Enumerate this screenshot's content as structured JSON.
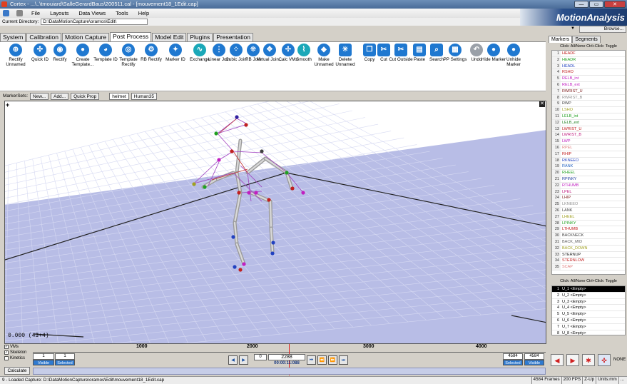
{
  "window": {
    "title": "Cortex - ...\\..\\tmouiard\\SalleGerardBaus\\200511.cal - [mouvement18_1Edit.cap]",
    "minimize": "—",
    "maximize": "▭",
    "close": "✕"
  },
  "menu": [
    "File",
    "Layouts",
    "Data Views",
    "Tools",
    "Help"
  ],
  "brand": "MotionAnalysis",
  "current_directory": {
    "label": "Current Directory:",
    "value": "D:\\DataMotionCapture\\oramos\\Edit\\",
    "browse": "Browse..."
  },
  "tabs": [
    "System",
    "Calibration",
    "Motion Capture",
    "Post Process",
    "Model Edit",
    "Plugins",
    "Presentation"
  ],
  "active_tab": "Post Process",
  "tools": [
    {
      "label": "Rectify Unnamed",
      "icon": "target-icon",
      "glyph": "⊕"
    },
    {
      "label": "Quick ID",
      "icon": "quick-id-icon",
      "glyph": "✣"
    },
    {
      "label": "Rectify",
      "icon": "rectify-icon",
      "glyph": "◉"
    },
    {
      "label": "Create Template...",
      "icon": "create-template-icon",
      "glyph": "●"
    },
    {
      "label": "Template ID",
      "icon": "template-id-icon",
      "glyph": "◕"
    },
    {
      "label": "Template Rectify",
      "icon": "template-rectify-icon",
      "glyph": "◎"
    },
    {
      "label": "RB Rectify",
      "icon": "rb-rectify-icon",
      "glyph": "⚙"
    },
    {
      "label": "Marker ID",
      "icon": "marker-id-icon",
      "glyph": "✦"
    },
    {
      "label": "Exchange",
      "icon": "exchange-icon",
      "glyph": "∿"
    },
    {
      "label": "Linear Join",
      "icon": "linear-join-icon",
      "glyph": "⋮"
    },
    {
      "label": "Cubic Join",
      "icon": "cubic-join-icon",
      "glyph": "⁘"
    },
    {
      "label": "RB Join",
      "icon": "rb-join-icon",
      "glyph": "⁜"
    },
    {
      "label": "Virtual Join...",
      "icon": "virtual-join-icon",
      "glyph": "✥"
    },
    {
      "label": "Calc VMs",
      "icon": "calc-vms-icon",
      "glyph": "✢"
    },
    {
      "label": "Smooth",
      "icon": "smooth-icon",
      "glyph": "⌇"
    },
    {
      "label": "Make Unnamed",
      "icon": "make-unnamed-icon",
      "glyph": "◆"
    },
    {
      "label": "Delete Unnamed",
      "icon": "delete-unnamed-icon",
      "glyph": "✳"
    },
    {
      "label": "Copy",
      "icon": "copy-icon",
      "glyph": "❐"
    },
    {
      "label": "Cut",
      "icon": "cut-icon",
      "glyph": "✂"
    },
    {
      "label": "Cut Outside",
      "icon": "cut-outside-icon",
      "glyph": "✂"
    },
    {
      "label": "Paste",
      "icon": "paste-icon",
      "glyph": "▤"
    },
    {
      "label": "Search",
      "icon": "search-icon",
      "glyph": "⌕"
    },
    {
      "label": "PP Settings",
      "icon": "pp-settings-icon",
      "glyph": "▦"
    },
    {
      "label": "Undo",
      "icon": "undo-icon",
      "glyph": "↶"
    },
    {
      "label": "Hide Marker",
      "icon": "hide-marker-icon",
      "glyph": "●"
    },
    {
      "label": "Unhide Marker",
      "icon": "unhide-marker-icon",
      "glyph": "●"
    }
  ],
  "markersets": {
    "label": "MarkerSets:",
    "new": "New...",
    "add": "Add...",
    "quickprop": "Quick Prop",
    "tabs": [
      "helmet",
      "Human35"
    ]
  },
  "viewport": {
    "frame_readout": "0.000 (43+4)",
    "plus": "+",
    "close": "✕"
  },
  "right_tabs": [
    "Markers",
    "Segments"
  ],
  "hint": "Click: All/None  Ctrl+Click: Toggle",
  "markers": [
    {
      "n": "1",
      "name": "HEADF",
      "color": "#c02020"
    },
    {
      "n": "2",
      "name": "HEADR",
      "color": "#20a020"
    },
    {
      "n": "3",
      "name": "HEADL",
      "color": "#2040c0"
    },
    {
      "n": "4",
      "name": "RSHO",
      "color": "#c02020"
    },
    {
      "n": "5",
      "name": "RELB_int",
      "color": "#c020c0"
    },
    {
      "n": "6",
      "name": "RELB_ext",
      "color": "#c020c0"
    },
    {
      "n": "7",
      "name": "RWRIST_U",
      "color": "#802020"
    },
    {
      "n": "8",
      "name": "RWRIST_B",
      "color": "#909090"
    },
    {
      "n": "9",
      "name": "RWP",
      "color": "#404040"
    },
    {
      "n": "10",
      "name": "LSHO",
      "color": "#a0a020"
    },
    {
      "n": "11",
      "name": "LELB_int",
      "color": "#20a020"
    },
    {
      "n": "12",
      "name": "LELB_ext",
      "color": "#208020"
    },
    {
      "n": "13",
      "name": "LWRIST_U",
      "color": "#c02020"
    },
    {
      "n": "14",
      "name": "LWRIST_B",
      "color": "#c02080"
    },
    {
      "n": "15",
      "name": "LWP",
      "color": "#c020c0"
    },
    {
      "n": "16",
      "name": "RPEL",
      "color": "#e08080"
    },
    {
      "n": "17",
      "name": "RHIP",
      "color": "#c02020"
    },
    {
      "n": "18",
      "name": "RKNEEO",
      "color": "#2040c0"
    },
    {
      "n": "19",
      "name": "RANK",
      "color": "#2060c0"
    },
    {
      "n": "20",
      "name": "RHEEL",
      "color": "#20a020"
    },
    {
      "n": "21",
      "name": "RPINKY",
      "color": "#2040a0"
    },
    {
      "n": "22",
      "name": "RTHUMB",
      "color": "#c020c0"
    },
    {
      "n": "23",
      "name": "LPEL",
      "color": "#c02080"
    },
    {
      "n": "24",
      "name": "LHIP",
      "color": "#802020"
    },
    {
      "n": "25",
      "name": "LKNEEO",
      "color": "#909090"
    },
    {
      "n": "26",
      "name": "LANK",
      "color": "#404040"
    },
    {
      "n": "27",
      "name": "LHEEL",
      "color": "#a0a020"
    },
    {
      "n": "28",
      "name": "LPINKY",
      "color": "#20a020"
    },
    {
      "n": "29",
      "name": "LTHUMB",
      "color": "#c02020"
    },
    {
      "n": "30",
      "name": "BACKNECK",
      "color": "#404040"
    },
    {
      "n": "31",
      "name": "BACK_MID",
      "color": "#606060"
    },
    {
      "n": "32",
      "name": "BACK_DOWN",
      "color": "#a0a020"
    },
    {
      "n": "33",
      "name": "STERNUP",
      "color": "#202020"
    },
    {
      "n": "34",
      "name": "STERNLOW",
      "color": "#c02020"
    },
    {
      "n": "35",
      "name": "SCAP",
      "color": "#e08080"
    }
  ],
  "unnamed": [
    {
      "n": "1",
      "name": "U_1 <Empty>"
    },
    {
      "n": "2",
      "name": "U_2 <Empty>"
    },
    {
      "n": "3",
      "name": "U_3 <Empty>"
    },
    {
      "n": "4",
      "name": "U_4 <Empty>"
    },
    {
      "n": "5",
      "name": "U_5 <Empty>"
    },
    {
      "n": "6",
      "name": "U_6 <Empty>"
    },
    {
      "n": "7",
      "name": "U_7 <Empty>"
    },
    {
      "n": "8",
      "name": "U_8 <Empty>"
    }
  ],
  "timeline": {
    "checks": [
      {
        "label": "VMs",
        "checked": true
      },
      {
        "label": "Skeleton",
        "checked": true
      },
      {
        "label": "Kinetics",
        "checked": false
      }
    ],
    "ticks": [
      "1000",
      "2000",
      "3000",
      "4000"
    ],
    "start_a": "1",
    "start_b": "1",
    "visible": "Visible",
    "selected": "Selected",
    "current_frame": "2288",
    "current_time": "00:00:11:088",
    "step": "0",
    "end_a": "4584",
    "end_b": "4584",
    "calculate": "Calculate"
  },
  "status": {
    "message": "9 - Loaded Capture: D:\\DataMotionCapture\\oramos\\Edit\\mouvement18_1Edit.cap",
    "frames": "4584 Frames",
    "fps": "200 FPS",
    "up": "Z-Up",
    "units": "Units:mm",
    "more": "..."
  },
  "none_label": "NONE"
}
